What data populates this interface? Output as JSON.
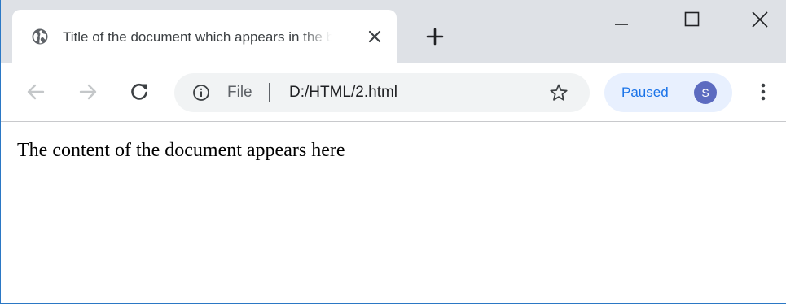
{
  "tab": {
    "title": "Title of the document which appears in the browser tab",
    "favicon_icon": "globe-icon",
    "close_icon": "close-icon"
  },
  "new_tab_icon": "plus-icon",
  "window_controls": {
    "minimize_icon": "minimize-icon",
    "maximize_icon": "maximize-icon",
    "close_icon": "close-icon"
  },
  "toolbar": {
    "back_icon": "arrow-left-icon",
    "forward_icon": "arrow-right-icon",
    "reload_icon": "reload-icon",
    "site_info_icon": "info-icon",
    "scheme_label": "File",
    "url": "D:/HTML/2.html",
    "bookmark_icon": "star-icon",
    "profile": {
      "status": "Paused",
      "avatar_initial": "S"
    },
    "menu_icon": "kebab-menu-icon"
  },
  "page": {
    "body_text": "The content of the document appears here"
  },
  "colors": {
    "tabstrip": "#dee1e6",
    "omnibox": "#f1f3f4",
    "profile_chip": "#e8f0fe",
    "profile_text": "#1a73e8",
    "avatar": "#5c6bc0",
    "window_border": "#2b78c5"
  }
}
